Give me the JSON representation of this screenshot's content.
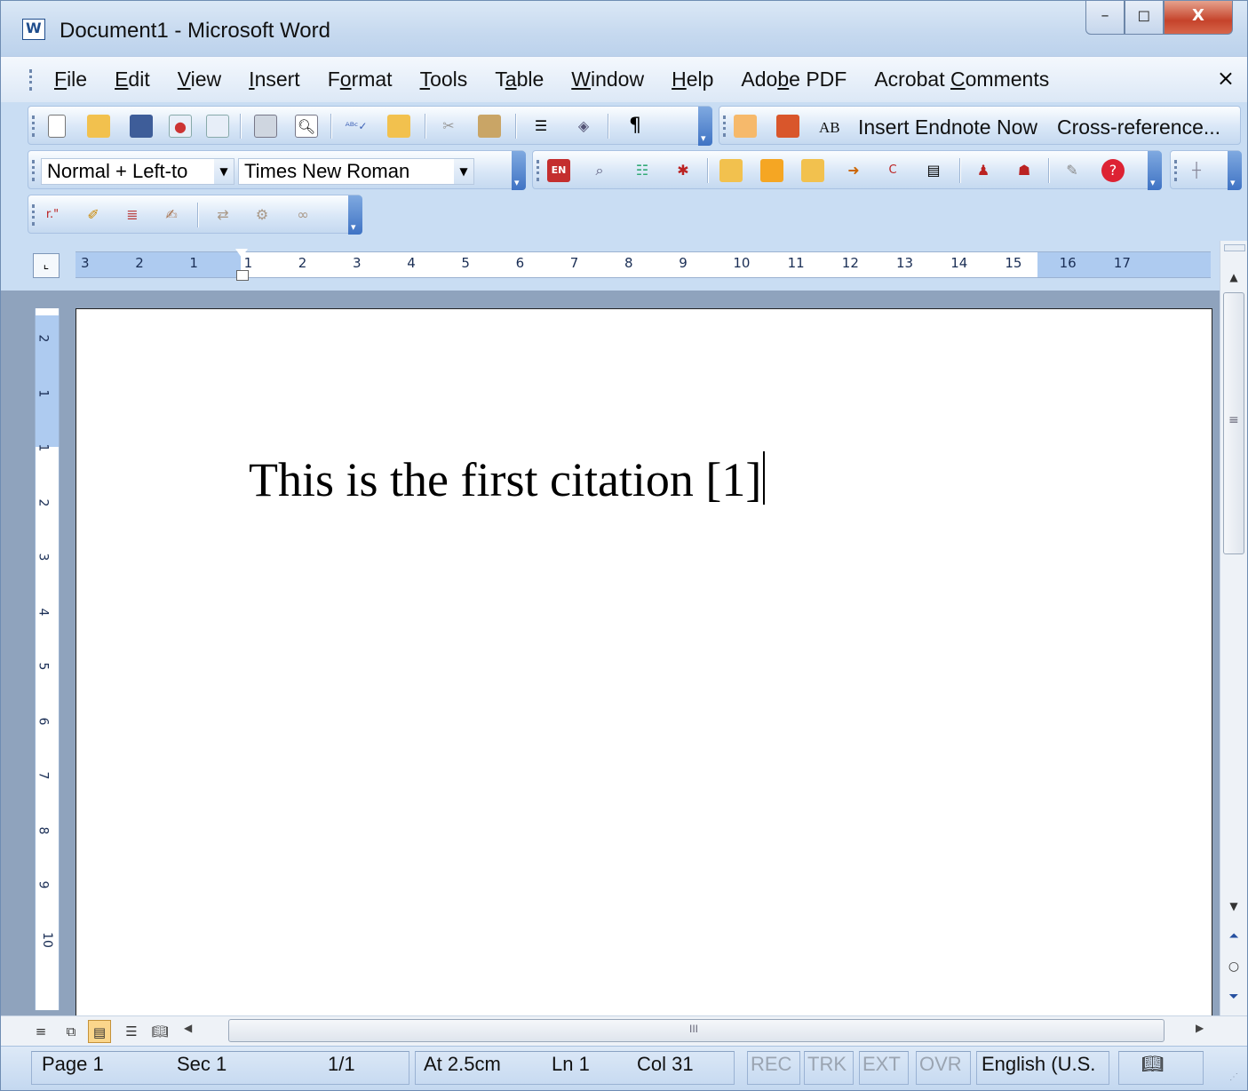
{
  "window": {
    "title": "Document1 - Microsoft Word",
    "minimize": "–",
    "restore": "◻",
    "close": "X"
  },
  "menu": {
    "items": [
      {
        "label": "File",
        "access": "F"
      },
      {
        "label": "Edit",
        "access": "E"
      },
      {
        "label": "View",
        "access": "V"
      },
      {
        "label": "Insert",
        "access": "I"
      },
      {
        "label": "Format",
        "access": "o"
      },
      {
        "label": "Tools",
        "access": "T"
      },
      {
        "label": "Table",
        "access": "a"
      },
      {
        "label": "Window",
        "access": "W"
      },
      {
        "label": "Help",
        "access": "H"
      },
      {
        "label": "Adobe PDF",
        "access": "b"
      },
      {
        "label": "Acrobat Comments",
        "access": "C"
      }
    ],
    "close_glyph": "×"
  },
  "toolbar_standard": {
    "icons": [
      "new-document-icon",
      "open-icon",
      "save-icon",
      "permission-icon",
      "print-icon",
      "print-preview-icon",
      "spelling-icon",
      "research-icon",
      "cut-icon",
      "paste-icon",
      "columns-icon",
      "drawing-icon",
      "pilcrow-icon"
    ]
  },
  "toolbar_endnote_insert": {
    "insert_endnote_now": "Insert Endnote Now",
    "cross_reference": "Cross-reference...",
    "ab_label": "AB"
  },
  "formatting": {
    "style_value": "Normal + Left-to",
    "font_value": "Times New Roman"
  },
  "ruler": {
    "h_numbers": [
      "3",
      "2",
      "1",
      "1",
      "2",
      "3",
      "4",
      "5",
      "6",
      "7",
      "8",
      "9",
      "10",
      "11",
      "12",
      "13",
      "14",
      "15",
      "16",
      "17"
    ],
    "v_numbers": [
      "2",
      "1",
      "1",
      "2",
      "3",
      "4",
      "5",
      "6",
      "7",
      "8",
      "9",
      "10"
    ]
  },
  "document": {
    "text": "This is the first citation [1]"
  },
  "status": {
    "page": "Page 1",
    "section": "Sec 1",
    "pages": "1/1",
    "at": "At 2.5cm",
    "line": "Ln 1",
    "column": "Col 31",
    "rec": "REC",
    "trk": "TRK",
    "ext": "EXT",
    "ovr": "OVR",
    "language": "English (U.S."
  }
}
